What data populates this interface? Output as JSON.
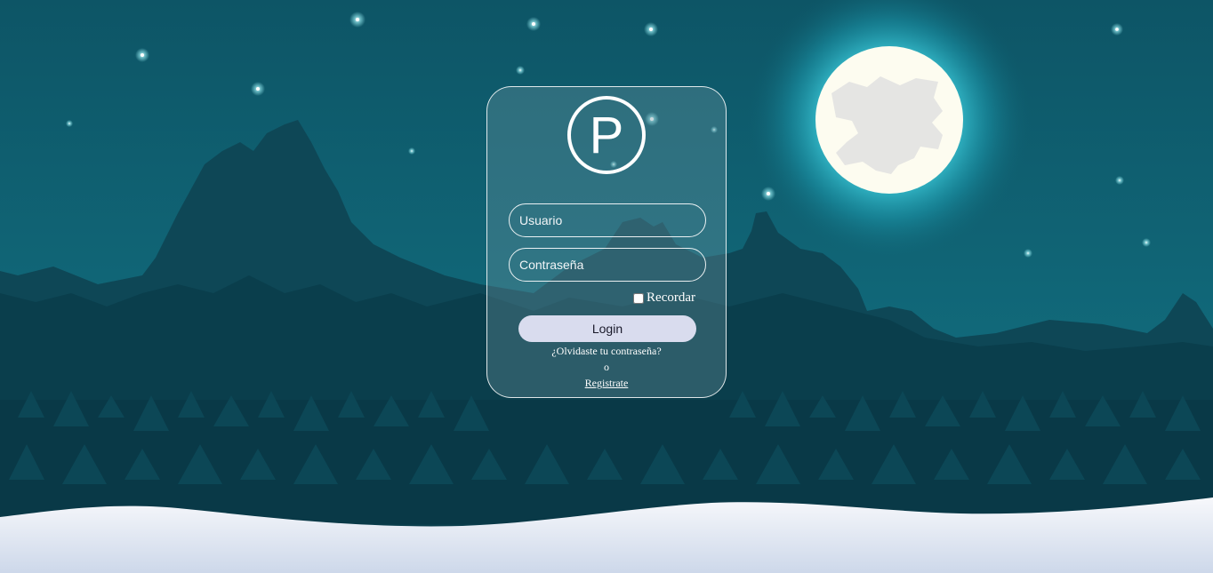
{
  "logo": {
    "letter": "P"
  },
  "login_form": {
    "username_placeholder": "Usuario",
    "username_value": "",
    "password_placeholder": "Contraseña",
    "password_value": "",
    "remember_label": "Recordar",
    "remember_checked": false,
    "login_label": "Login",
    "forgot_label": "¿Olvidaste tu contraseña?",
    "or_label": "o",
    "register_label": "Registrate"
  },
  "colors": {
    "sky": "#0f5a6b",
    "mountain_back": "#0e4453",
    "mountain_front": "#083b48",
    "moon": "#fdfcf0",
    "moon_glow": "#2fb8c9",
    "snow": "#e8edf6",
    "button": "#d9dcee"
  }
}
